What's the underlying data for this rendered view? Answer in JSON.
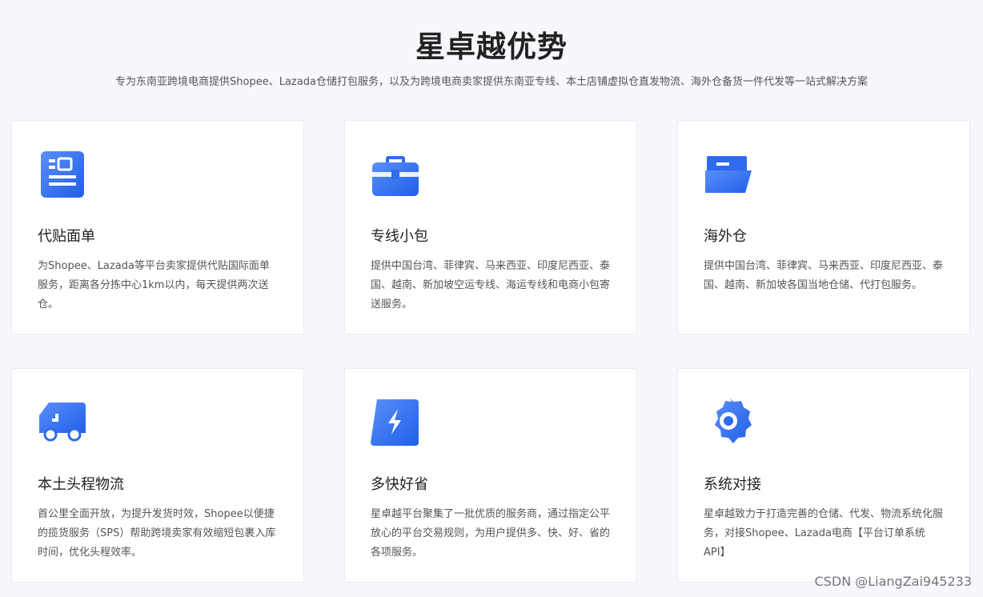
{
  "header": {
    "title": "星卓越优势",
    "subtitle": "专为东南亚跨境电商提供Shopee、Lazada仓储打包服务，以及为跨境电商卖家提供东南亚专线、本土店铺虚拟仓直发物流、海外仓备货一件代发等一站式解决方案"
  },
  "cards": [
    {
      "icon": "document-icon",
      "title": "代贴面单",
      "desc": "为Shopee、Lazada等平台卖家提供代贴国际面单服务，距离各分拣中心1km以内，每天提供两次送仓。"
    },
    {
      "icon": "briefcase-icon",
      "title": "专线小包",
      "desc": "提供中国台湾、菲律宾、马来西亚、印度尼西亚、泰国、越南、新加坡空运专线、海运专线和电商小包寄送服务。"
    },
    {
      "icon": "folder-icon",
      "title": "海外仓",
      "desc": "提供中国台湾、菲律宾、马来西亚、印度尼西亚、泰国、越南、新加坡各国当地仓储、代打包服务。"
    },
    {
      "icon": "truck-icon",
      "title": "本土头程物流",
      "desc": "首公里全面开放，为提升发货时效，Shopee以便捷的揽货服务（SPS）帮助跨境卖家有效缩短包裹入库时间，优化头程效率。"
    },
    {
      "icon": "lightning-icon",
      "title": "多快好省",
      "desc": "星卓越平台聚集了一批优质的服务商，通过指定公平放心的平台交易规则，为用户提供多、快、好、省的各项服务。"
    },
    {
      "icon": "gear-icon",
      "title": "系统对接",
      "desc": "星卓越致力于打造完善的仓储、代发、物流系统化服务，对接Shopee、Lazada电商【平台订单系统API】"
    }
  ],
  "watermark": "CSDN @LiangZai945233",
  "colors": {
    "accent": "#3478f6",
    "accent_dark": "#2563eb"
  }
}
